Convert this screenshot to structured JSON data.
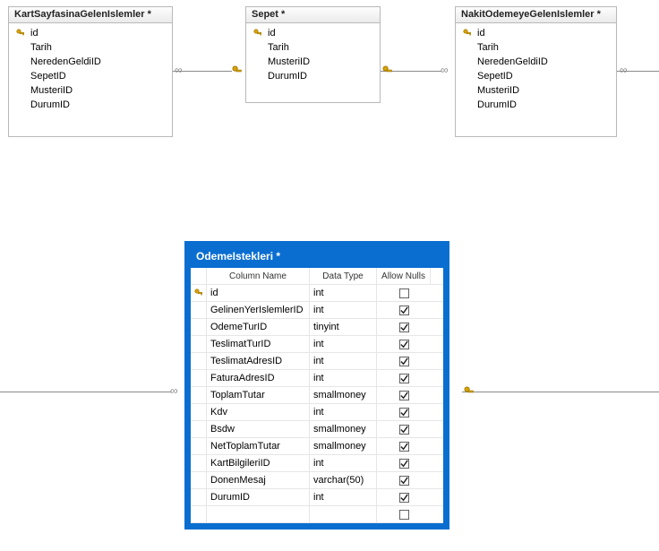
{
  "tables": {
    "kart": {
      "title": "KartSayfasinaGelenIslemler *",
      "cols": [
        "id",
        "Tarih",
        "NeredenGeldiID",
        "SepetID",
        "MusteriID",
        "DurumID"
      ],
      "pk": 0
    },
    "sepet": {
      "title": "Sepet *",
      "cols": [
        "id",
        "Tarih",
        "MusteriID",
        "DurumID"
      ],
      "pk": 0
    },
    "nakit": {
      "title": "NakitOdemeyeGelenIslemler *",
      "cols": [
        "id",
        "Tarih",
        "NeredenGeldiID",
        "SepetID",
        "MusteriID",
        "DurumID"
      ],
      "pk": 0
    }
  },
  "designer": {
    "title": "OdemeIstekleri *",
    "headers": {
      "name": "Column Name",
      "type": "Data Type",
      "null": "Allow Nulls"
    },
    "rows": [
      {
        "name": "id",
        "type": "int",
        "null": false,
        "pk": true
      },
      {
        "name": "GelinenYerIslemlerID",
        "type": "int",
        "null": true
      },
      {
        "name": "OdemeTurID",
        "type": "tinyint",
        "null": true
      },
      {
        "name": "TeslimatTurID",
        "type": "int",
        "null": true
      },
      {
        "name": "TeslimatAdresID",
        "type": "int",
        "null": true
      },
      {
        "name": "FaturaAdresID",
        "type": "int",
        "null": true
      },
      {
        "name": "ToplamTutar",
        "type": "smallmoney",
        "null": true
      },
      {
        "name": "Kdv",
        "type": "int",
        "null": true
      },
      {
        "name": "Bsdw",
        "type": "smallmoney",
        "null": true
      },
      {
        "name": "NetToplamTutar",
        "type": "smallmoney",
        "null": true
      },
      {
        "name": "KartBilgileriID",
        "type": "int",
        "null": true
      },
      {
        "name": "DonenMesaj",
        "type": "varchar(50)",
        "null": true
      },
      {
        "name": "DurumID",
        "type": "int",
        "null": true
      },
      {
        "name": "",
        "type": "",
        "null": false,
        "blanknull": false
      }
    ]
  },
  "icons": {
    "key": "key-icon"
  },
  "colors": {
    "accent": "#0a6ed1"
  }
}
